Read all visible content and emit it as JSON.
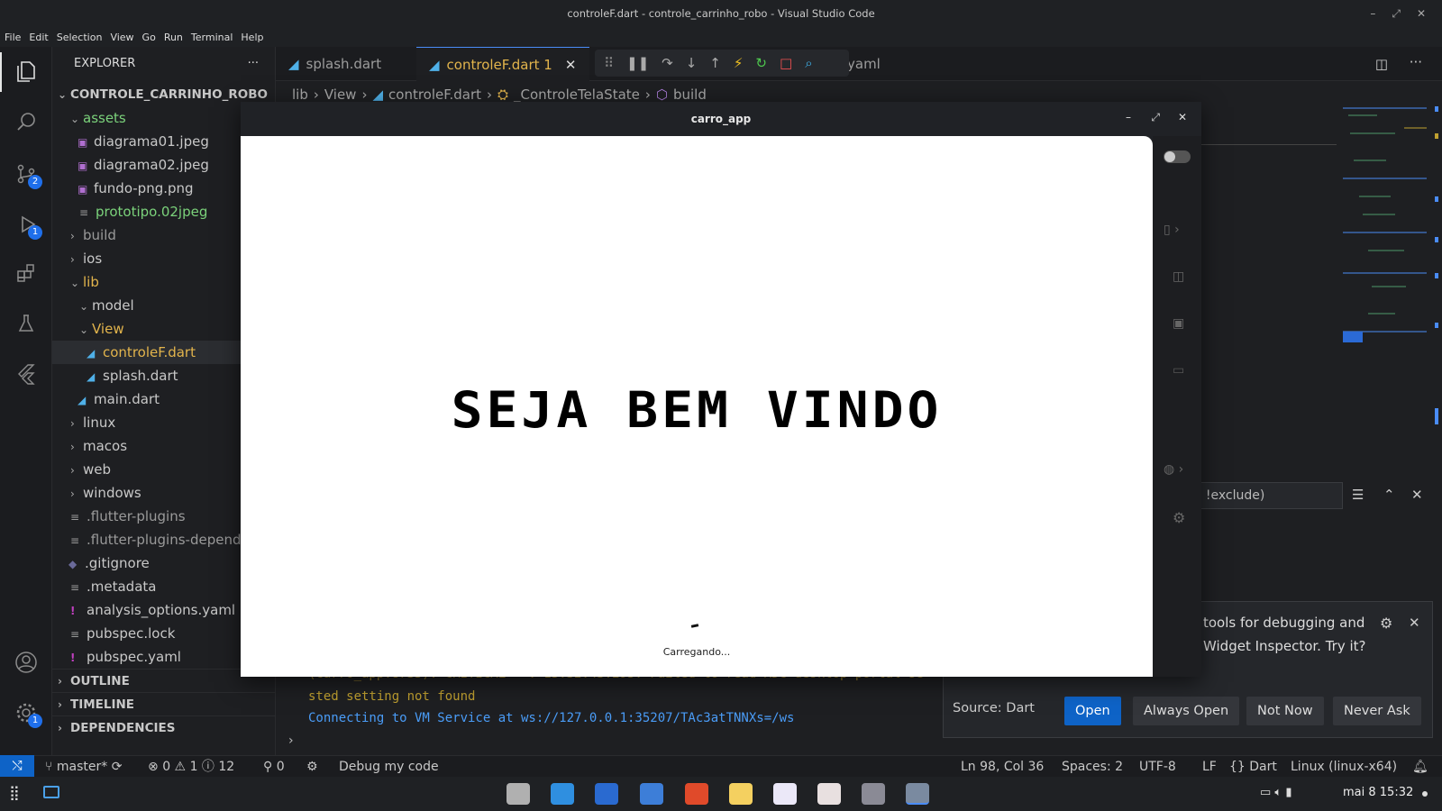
{
  "window": {
    "title": "controleF.dart - controle_carrinho_robo - Visual Studio Code"
  },
  "menu": [
    "File",
    "Edit",
    "Selection",
    "View",
    "Go",
    "Run",
    "Terminal",
    "Help"
  ],
  "activity": {
    "scm_badge": "2",
    "debug_badge": "1",
    "settings_badge": "1"
  },
  "explorer": {
    "header": "EXPLORER",
    "project": "CONTROLE_CARRINHO_ROBO",
    "items": [
      {
        "label": "assets"
      },
      {
        "label": "diagrama01.jpeg"
      },
      {
        "label": "diagrama02.jpeg"
      },
      {
        "label": "fundo-png.png"
      },
      {
        "label": "prototipo.02jpeg"
      },
      {
        "label": "build"
      },
      {
        "label": "ios"
      },
      {
        "label": "lib"
      },
      {
        "label": "model"
      },
      {
        "label": "View"
      },
      {
        "label": "controleF.dart"
      },
      {
        "label": "splash.dart"
      },
      {
        "label": "main.dart"
      },
      {
        "label": "linux"
      },
      {
        "label": "macos"
      },
      {
        "label": "web"
      },
      {
        "label": "windows"
      },
      {
        "label": ".flutter-plugins"
      },
      {
        "label": ".flutter-plugins-depend"
      },
      {
        "label": ".gitignore"
      },
      {
        "label": ".metadata"
      },
      {
        "label": "analysis_options.yaml"
      },
      {
        "label": "pubspec.lock"
      },
      {
        "label": "pubspec.yaml"
      }
    ],
    "sections": [
      "OUTLINE",
      "TIMELINE",
      "DEPENDENCIES"
    ]
  },
  "tabs": [
    {
      "label": "splash.dart"
    },
    {
      "label": "controleF.dart 1"
    },
    {
      "label": "yaml"
    }
  ],
  "breadcrumb": [
    "lib",
    "View",
    "controleF.dart",
    "_ControleTelaState",
    "build"
  ],
  "terminal": {
    "line1": "(carro_app:8735): CRITICAL **: 15:32:43.295: Failed to read XDG desktop portal se",
    "line2": "sted setting not found",
    "line3": "Connecting to VM Service at ws://127.0.0.1:35207/TAc3atTNNXs=/ws",
    "filter_placeholder": ", !exclude)"
  },
  "notification": {
    "line1": "tools for debugging and",
    "line2": "Widget Inspector. Try it?",
    "source": "Source: Dart",
    "buttons": {
      "open": "Open",
      "always_open": "Always Open",
      "not_now": "Not Now",
      "never_ask": "Never Ask"
    }
  },
  "statusbar": {
    "branch": "master*",
    "errors": "0",
    "warnings": "1",
    "infos": "12",
    "ports": "0",
    "debug": "Debug my code",
    "position": "Ln 98, Col 36",
    "spaces": "Spaces: 2",
    "encoding": "UTF-8",
    "eol": "LF",
    "language": "Dart",
    "platform": "Linux (linux-x64)"
  },
  "app": {
    "title": "carro_app",
    "welcome": "SEJA BEM VINDO",
    "loading": "Carregando..."
  },
  "taskbar": {
    "clock": "mai 8  15:32"
  }
}
